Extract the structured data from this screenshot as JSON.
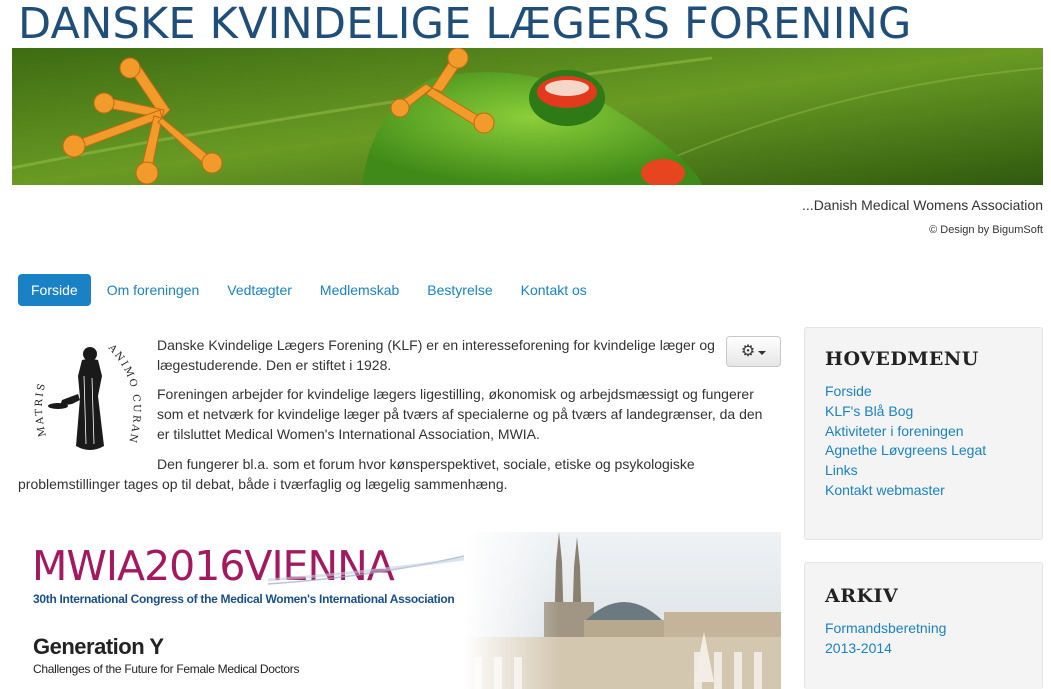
{
  "header": {
    "site_title": "DANSKE KVINDELIGE LÆGERS FORENING",
    "tagline": "...Danish Medical Womens Association",
    "credit": "© Design by BigumSoft"
  },
  "nav": {
    "items": [
      {
        "label": "Forside",
        "active": true
      },
      {
        "label": "Om foreningen",
        "active": false
      },
      {
        "label": "Vedtægter",
        "active": false
      },
      {
        "label": "Medlemskab",
        "active": false
      },
      {
        "label": "Bestyrelse",
        "active": false
      },
      {
        "label": "Kontakt os",
        "active": false
      }
    ]
  },
  "main": {
    "logo_text": "MATRIS ANIMO CURANT",
    "paragraph1": "Danske Kvindelige Lægers Forening (KLF) er en interesseforening for kvindelige læger og lægestuderende. Den er stiftet i 1928.",
    "paragraph2": "Foreningen arbejder for kvindelige lægers ligestilling, økonomisk og arbejdsmæssigt og fungerer som et netværk for kvindelige læger på tværs af specialerne og på tværs af landegrænser, da den er tilsluttet Medical Women's International Association, MWIA.",
    "paragraph3_line1": "Den fungerer bl.a. som et forum hvor kønsperspektivet, sociale, etiske og psykologiske",
    "paragraph3_line2": "problemstillinger tages op til debat, både i tværfaglig og lægelig sammenhæng.",
    "event": {
      "title_part1": "MWIA",
      "title_part2": "2016",
      "title_part3": "VIENNA",
      "subtitle": "30th International Congress of the Medical Women's International Association",
      "headline": "Generation Y",
      "tagline": "Challenges of the Future for Female Medical Doctors"
    }
  },
  "sidebar": {
    "menu_title": "HOVEDMENU",
    "menu_items": [
      "Forside",
      "KLF's Blå Bog",
      "Aktiviteter i foreningen",
      "Agnethe Løvgreens Legat",
      "Links",
      "Kontakt webmaster"
    ],
    "archive_title": "ARKIV",
    "archive_items": [
      "Formandsberetning",
      "2013-2014"
    ]
  },
  "colors": {
    "title": "#1f4e79",
    "link": "#1a82c4",
    "event_title": "#a3185f",
    "event_subtitle": "#1b4f8a"
  }
}
